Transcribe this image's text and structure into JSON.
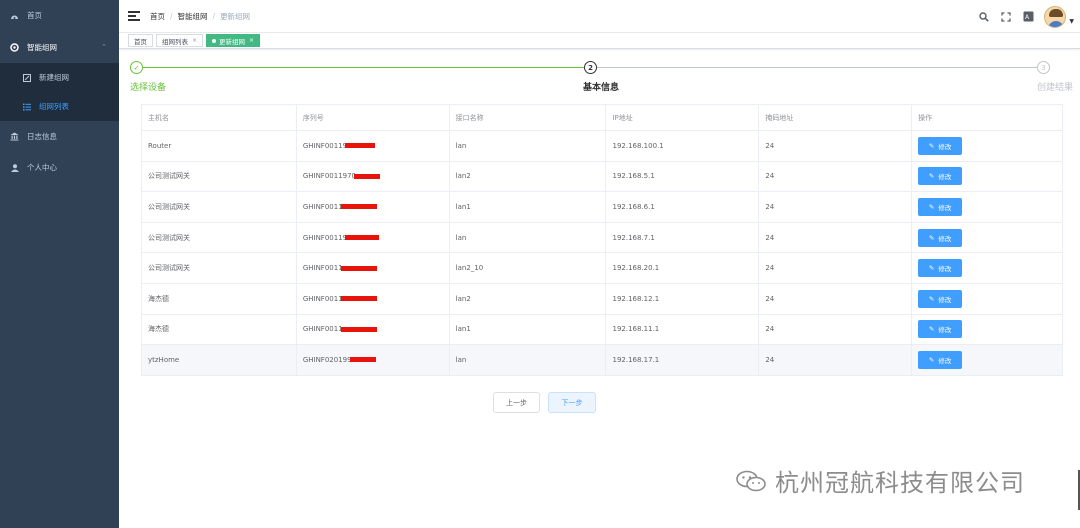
{
  "sidebar": {
    "items": [
      {
        "label": "首页",
        "icon": "dashboard-icon"
      },
      {
        "label": "智能组网",
        "icon": "network-icon"
      },
      {
        "label": "新建组网",
        "icon": "create-icon"
      },
      {
        "label": "组网列表",
        "icon": "list-icon"
      },
      {
        "label": "日志信息",
        "icon": "log-icon"
      },
      {
        "label": "个人中心",
        "icon": "user-icon"
      }
    ]
  },
  "header": {
    "breadcrumb": [
      "首页",
      "智能组网",
      "更新组网"
    ],
    "icons": [
      "search-icon",
      "fullscreen-icon",
      "font-size-icon"
    ]
  },
  "tags": {
    "items": [
      {
        "label": "首页"
      },
      {
        "label": "组网列表"
      },
      {
        "label": "更新组网"
      }
    ]
  },
  "steps": {
    "items": [
      {
        "title": "选择设备",
        "status": "done",
        "mark": "✓"
      },
      {
        "title": "基本信息",
        "status": "process",
        "mark": "2"
      },
      {
        "title": "创建结果",
        "status": "wait",
        "mark": "3"
      }
    ]
  },
  "table": {
    "headers": [
      "主机名",
      "序列号",
      "接口名称",
      "IP地址",
      "掩码地址",
      "操作"
    ],
    "edit_label": "修改",
    "rows": [
      {
        "host": "Router",
        "serial": "GHINF00119",
        "iface": "lan",
        "ip": "192.168.100.1",
        "mask": "24"
      },
      {
        "host": "公司测试网关",
        "serial": "GHINF0011970",
        "iface": "lan2",
        "ip": "192.168.5.1",
        "mask": "24"
      },
      {
        "host": "公司测试网关",
        "serial": "GHINF0011",
        "iface": "lan1",
        "ip": "192.168.6.1",
        "mask": "24"
      },
      {
        "host": "公司测试网关",
        "serial": "GHINF00119",
        "iface": "lan",
        "ip": "192.168.7.1",
        "mask": "24"
      },
      {
        "host": "公司测试网关",
        "serial": "GHINF0011",
        "iface": "lan2_10",
        "ip": "192.168.20.1",
        "mask": "24"
      },
      {
        "host": "海杰德",
        "serial": "GHINF0011",
        "iface": "lan2",
        "ip": "192.168.12.1",
        "mask": "24"
      },
      {
        "host": "海杰德",
        "serial": "GHINF0011",
        "iface": "lan1",
        "ip": "192.168.11.1",
        "mask": "24"
      },
      {
        "host": "ytzHome",
        "serial": "GHINF020199",
        "iface": "lan",
        "ip": "192.168.17.1",
        "mask": "24"
      }
    ]
  },
  "buttons": {
    "prev": "上一步",
    "next": "下一步"
  },
  "watermark": {
    "text": "杭州冠航科技有限公司"
  },
  "colors": {
    "sidebar_bg": "#304156",
    "primary": "#409eff",
    "success": "#67c23a",
    "tag_active": "#42b983",
    "redaction": "#e8140c"
  }
}
